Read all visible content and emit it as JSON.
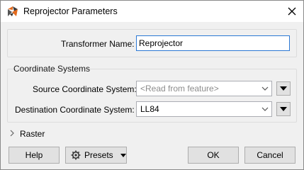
{
  "window": {
    "title": "Reprojector Parameters"
  },
  "transformer": {
    "label": "Transformer Name:",
    "value": "Reprojector"
  },
  "coord_systems": {
    "heading": "Coordinate Systems",
    "source": {
      "label": "Source Coordinate System:",
      "placeholder": "<Read from feature>"
    },
    "destination": {
      "label": "Destination Coordinate System:",
      "value": "LL84"
    }
  },
  "raster": {
    "label": "Raster"
  },
  "buttons": {
    "help": "Help",
    "presets": "Presets",
    "ok": "OK",
    "cancel": "Cancel"
  }
}
